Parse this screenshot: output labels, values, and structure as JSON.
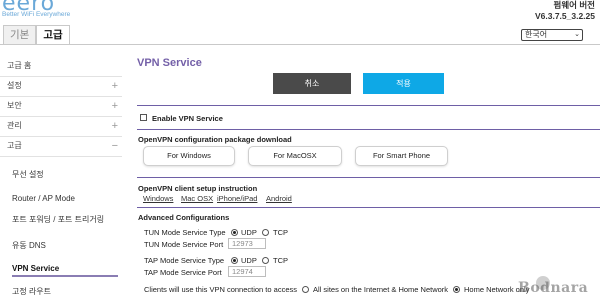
{
  "header": {
    "logo": "eero",
    "tagline": "Better WiFi Everywhere",
    "firmware_label": "펌웨어 버전",
    "firmware_version": "V6.3.7.5_3.2.25",
    "language": "한국어"
  },
  "tabs": [
    {
      "label": "기본",
      "active": false
    },
    {
      "label": "고급",
      "active": true
    }
  ],
  "sidebar": {
    "items": [
      {
        "label": "고급 홈",
        "expandable": false
      },
      {
        "label": "설정",
        "expandable": true,
        "sign": "+"
      },
      {
        "label": "보안",
        "expandable": true,
        "sign": "+"
      },
      {
        "label": "관리",
        "expandable": true,
        "sign": "+"
      },
      {
        "label": "고급",
        "expandable": true,
        "sign": "−"
      }
    ],
    "subitems": [
      {
        "label": "무선 설정",
        "active": false
      },
      {
        "label": "Router / AP Mode",
        "active": false
      },
      {
        "label": "포트 포워딩 / 포트 트리거링",
        "active": false
      },
      {
        "label": "유동 DNS",
        "active": false
      },
      {
        "label": "VPN Service",
        "active": true
      },
      {
        "label": "고정 라우트",
        "active": false
      }
    ]
  },
  "main": {
    "title": "VPN Service",
    "cancel_label": "취소",
    "apply_label": "적용",
    "enable_label": "Enable VPN Service",
    "enable_checked": false,
    "download_heading": "OpenVPN configuration package download",
    "download_buttons": [
      "For Windows",
      "For MacOSX",
      "For Smart Phone"
    ],
    "instruction_heading": "OpenVPN client setup instruction",
    "instruction_links": [
      "Windows",
      "Mac OSX",
      "iPhone/iPad",
      "Android"
    ],
    "advanced_heading": "Advanced Configurations",
    "tun_type_label": "TUN Mode Service Type",
    "tun_port_label": "TUN Mode Service Port",
    "tun_port_value": "12973",
    "tap_type_label": "TAP Mode Service Type",
    "tap_port_label": "TAP Mode Service Port",
    "tap_port_value": "12974",
    "udp_label": "UDP",
    "tcp_label": "TCP",
    "tun_protocol_selected": "UDP",
    "tap_protocol_selected": "UDP",
    "clients_label": "Clients will use this VPN connection to access",
    "access_options": [
      "All sites on the Internet & Home Network",
      "Home Network only"
    ],
    "access_selected": "Home Network only"
  },
  "watermark": "Bodnara",
  "colors": {
    "accent_purple": "#7460a8",
    "apply_blue": "#0ea8e6",
    "cancel_gray": "#4a4a4a",
    "logo_blue": "#6aa8d8"
  }
}
